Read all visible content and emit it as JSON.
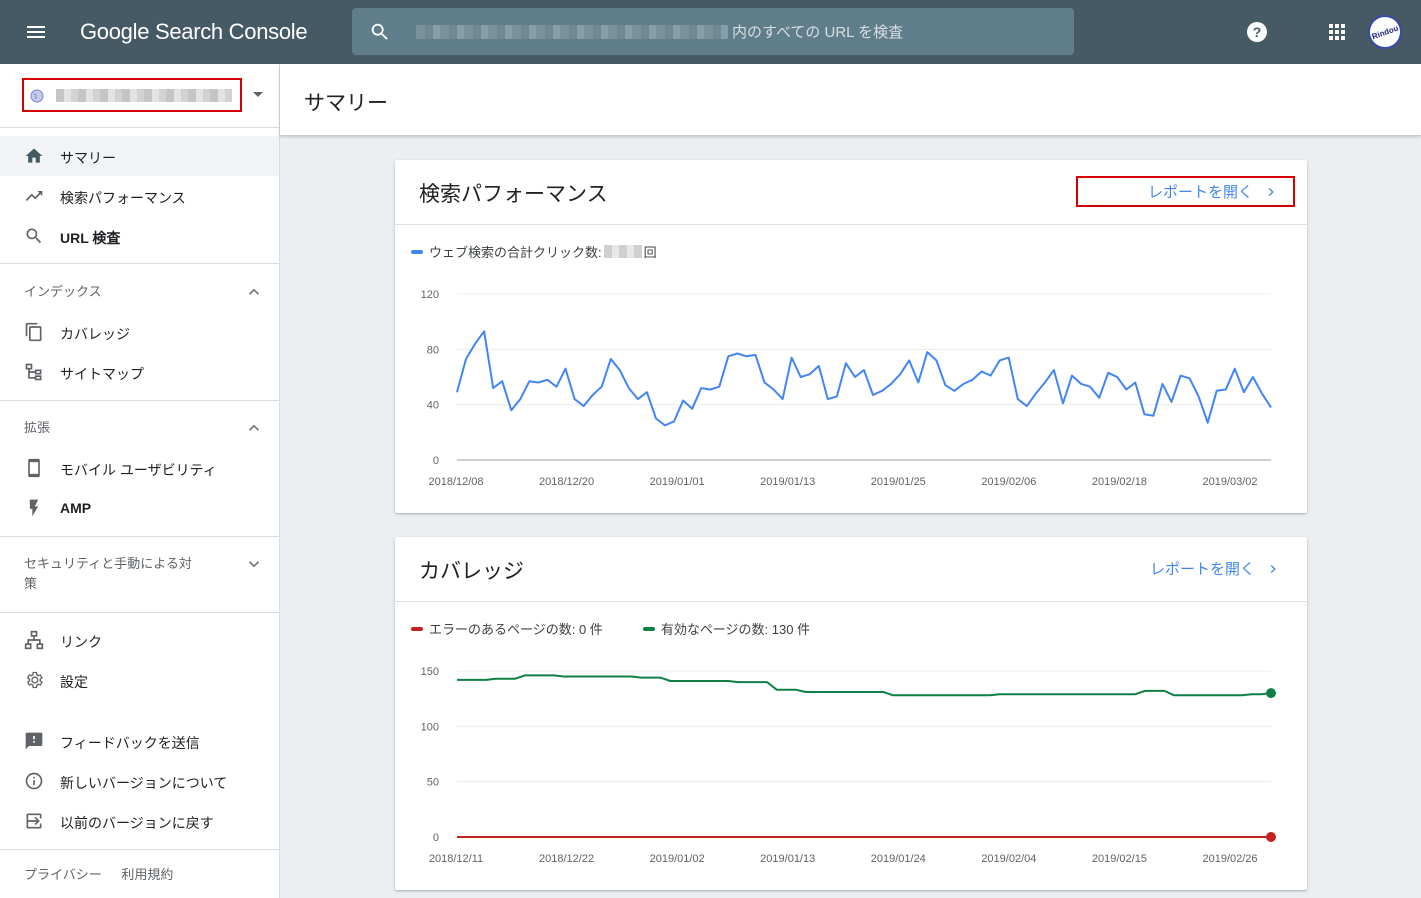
{
  "app": {
    "brand": "Google Search Console"
  },
  "search": {
    "placeholder": "内のすべての URL を検査"
  },
  "avatar": {
    "text": "Rindou"
  },
  "page": {
    "title": "サマリー"
  },
  "sidebar": {
    "main_items": [
      {
        "label": "サマリー",
        "icon": "home-icon"
      },
      {
        "label": "検索パフォーマンス",
        "icon": "trending-up-icon"
      },
      {
        "label": "URL 検査",
        "icon": "search-icon"
      }
    ],
    "index_section": {
      "label": "インデックス",
      "items": [
        {
          "label": "カバレッジ",
          "icon": "copy-icon"
        },
        {
          "label": "サイトマップ",
          "icon": "sitemap-icon"
        }
      ]
    },
    "enhancements_section": {
      "label": "拡張",
      "items": [
        {
          "label": "モバイル ユーザビリティ",
          "icon": "smartphone-icon"
        },
        {
          "label": "AMP",
          "icon": "flash-icon"
        }
      ]
    },
    "security_section": {
      "label_line1": "セキュリティと手動による対",
      "label_line2": "策"
    },
    "tools": [
      {
        "label": "リンク",
        "icon": "links-icon"
      },
      {
        "label": "設定",
        "icon": "gear-icon"
      }
    ],
    "feedback": [
      {
        "label": "フィードバックを送信",
        "icon": "feedback-icon"
      },
      {
        "label": "新しいバージョンについて",
        "icon": "info-icon"
      },
      {
        "label": "以前のバージョンに戻す",
        "icon": "exit-icon"
      }
    ],
    "footer": {
      "privacy": "プライバシー",
      "terms": "利用規約"
    }
  },
  "performance_card": {
    "title": "検索パフォーマンス",
    "open_report": "レポートを開く",
    "legend_prefix": "ウェブ検索の合計クリック数: ",
    "legend_suffix": "回"
  },
  "coverage_card": {
    "title": "カバレッジ",
    "open_report": "レポートを開く",
    "legend_error": "エラーのあるページの数: 0 件",
    "legend_valid": "有効なページの数: 130 件"
  },
  "colors": {
    "topbar": "#455a64",
    "link": "#4285f4",
    "clicks": "#4285f4",
    "error": "#c5221f",
    "valid": "#0d8043",
    "highlight": "#d50000"
  },
  "chart_data": [
    {
      "type": "line",
      "series": [
        {
          "name": "ウェブ検索の合計クリック数",
          "color": "#4285f4",
          "values": [
            49,
            73,
            84,
            93,
            52,
            57,
            36,
            44,
            57,
            56,
            58,
            53,
            66,
            44,
            39,
            47,
            53,
            73,
            65,
            52,
            44,
            49,
            30,
            25,
            28,
            43,
            37,
            52,
            51,
            53,
            75,
            77,
            75,
            76,
            56,
            51,
            44,
            74,
            60,
            62,
            68,
            44,
            46,
            70,
            60,
            65,
            47,
            50,
            55,
            62,
            72,
            56,
            78,
            72,
            54,
            50,
            55,
            58,
            64,
            61,
            72,
            74,
            44,
            39,
            48,
            56,
            65,
            41,
            61,
            55,
            53,
            45,
            63,
            60,
            51,
            56,
            33,
            32,
            55,
            42,
            61,
            59,
            46,
            27,
            50,
            51,
            66,
            49,
            60,
            48,
            38
          ]
        }
      ],
      "x_ticks": [
        "2018/12/08",
        "2018/12/20",
        "2019/01/01",
        "2019/01/13",
        "2019/01/25",
        "2019/02/06",
        "2019/02/18",
        "2019/03/02"
      ],
      "y_ticks": [
        0,
        40,
        80,
        120
      ],
      "ylim": [
        0,
        120
      ],
      "grid": true
    },
    {
      "type": "line",
      "series": [
        {
          "name": "エラーのあるページの数",
          "color": "#c5221f",
          "values": [
            0,
            0,
            0,
            0,
            0,
            0,
            0,
            0,
            0,
            0,
            0,
            0,
            0,
            0,
            0,
            0,
            0,
            0,
            0,
            0,
            0,
            0,
            0,
            0,
            0,
            0,
            0,
            0,
            0,
            0,
            0,
            0,
            0,
            0,
            0,
            0,
            0,
            0,
            0,
            0,
            0,
            0,
            0,
            0,
            0,
            0,
            0,
            0,
            0,
            0,
            0,
            0,
            0,
            0,
            0,
            0,
            0,
            0,
            0,
            0,
            0,
            0,
            0,
            0,
            0,
            0,
            0,
            0,
            0,
            0,
            0,
            0,
            0,
            0,
            0,
            0,
            0,
            0,
            0,
            0,
            0
          ]
        },
        {
          "name": "有効なページの数",
          "color": "#0d8043",
          "values": [
            142,
            142,
            142,
            142,
            143,
            143,
            143,
            146,
            146,
            146,
            146,
            145,
            145,
            145,
            145,
            145,
            145,
            145,
            145,
            144,
            144,
            144,
            141,
            141,
            141,
            141,
            141,
            141,
            141,
            140,
            140,
            140,
            140,
            133,
            133,
            133,
            131,
            131,
            131,
            131,
            131,
            131,
            131,
            131,
            131,
            128,
            128,
            128,
            128,
            128,
            128,
            128,
            128,
            128,
            128,
            128,
            129,
            129,
            129,
            129,
            129,
            129,
            129,
            129,
            129,
            129,
            129,
            129,
            129,
            129,
            129,
            132,
            132,
            132,
            128,
            128,
            128,
            128,
            128,
            128,
            128,
            128,
            129,
            129,
            130
          ]
        }
      ],
      "x_ticks": [
        "2018/12/11",
        "2018/12/22",
        "2019/01/02",
        "2019/01/13",
        "2019/01/24",
        "2019/02/04",
        "2019/02/15",
        "2019/02/26"
      ],
      "y_ticks": [
        0,
        50,
        100,
        150
      ],
      "ylim": [
        0,
        150
      ],
      "grid": true
    }
  ]
}
